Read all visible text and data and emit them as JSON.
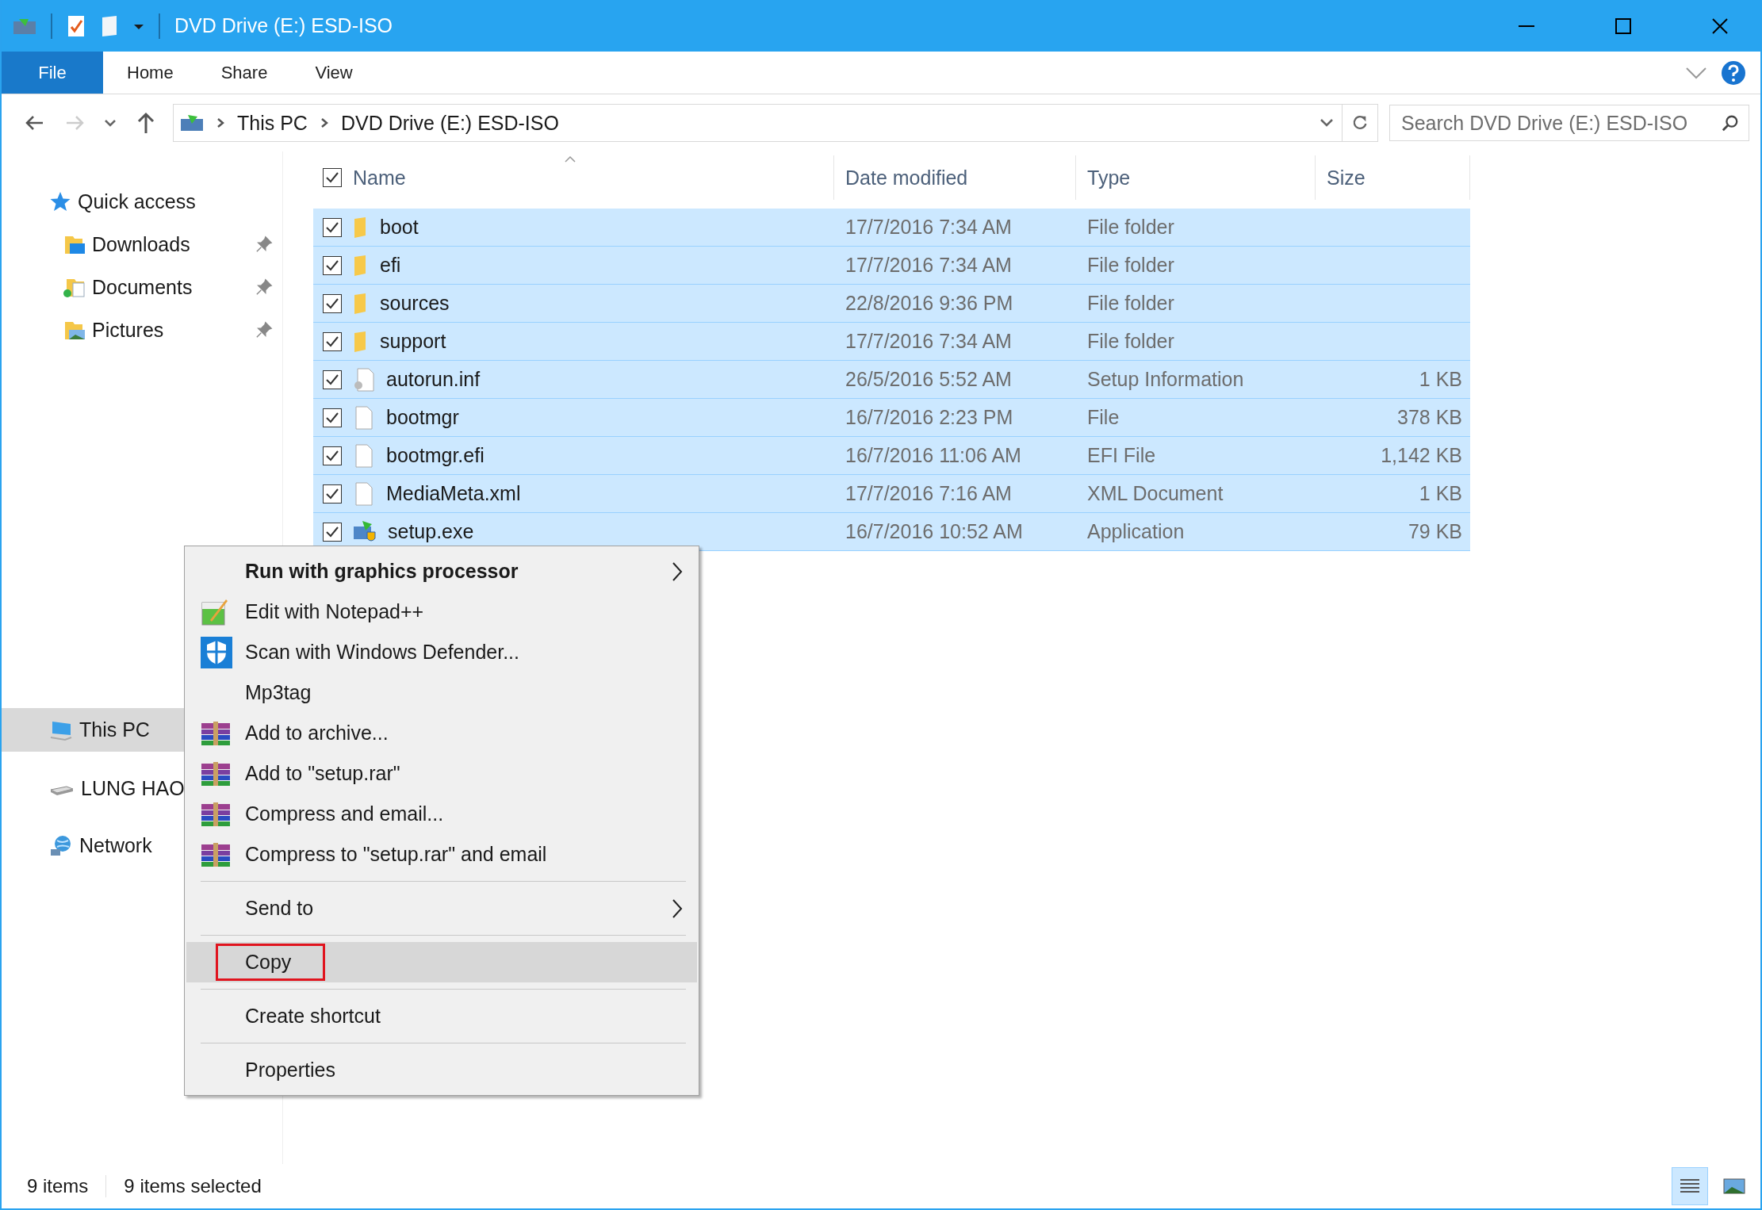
{
  "window": {
    "title": "DVD Drive (E:) ESD-ISO"
  },
  "ribbon_tabs": [
    {
      "label": "File",
      "kind": "file",
      "selected": false
    },
    {
      "label": "Home",
      "kind": "tab",
      "selected": false
    },
    {
      "label": "Share",
      "kind": "tab",
      "selected": false
    },
    {
      "label": "View",
      "kind": "tab",
      "selected": false
    }
  ],
  "address_bar": {
    "path": [
      "This PC",
      "DVD Drive (E:) ESD-ISO"
    ]
  },
  "search": {
    "placeholder": "Search DVD Drive (E:) ESD-ISO"
  },
  "sidebar": {
    "sections": [
      {
        "items": [
          {
            "label": "Quick access",
            "kind": "star",
            "selected": false,
            "children": [
              {
                "label": "Downloads",
                "kind": "downloads",
                "selected": false,
                "pinned": true
              },
              {
                "label": "Documents",
                "kind": "documents",
                "selected": false,
                "pinned": true
              },
              {
                "label": "Pictures",
                "kind": "pictures",
                "selected": false,
                "pinned": true
              }
            ]
          }
        ]
      },
      {
        "items": [
          {
            "label": "This PC",
            "kind": "pc",
            "selected": true
          },
          {
            "label": "LUNG HAO",
            "kind": "drive",
            "selected": false
          },
          {
            "label": "Network",
            "kind": "network",
            "selected": false
          }
        ]
      }
    ]
  },
  "table": {
    "all_checked": true,
    "columns": [
      "Name",
      "Date modified",
      "Type",
      "Size"
    ],
    "rows": [
      {
        "name": "boot",
        "date": "17/7/2016 7:34 AM",
        "type": "File folder",
        "size": "",
        "kind": "folder",
        "checked": true,
        "selected": true
      },
      {
        "name": "efi",
        "date": "17/7/2016 7:34 AM",
        "type": "File folder",
        "size": "",
        "kind": "folder",
        "checked": true,
        "selected": true
      },
      {
        "name": "sources",
        "date": "22/8/2016 9:36 PM",
        "type": "File folder",
        "size": "",
        "kind": "folder",
        "checked": true,
        "selected": true
      },
      {
        "name": "support",
        "date": "17/7/2016 7:34 AM",
        "type": "File folder",
        "size": "",
        "kind": "folder",
        "checked": true,
        "selected": true
      },
      {
        "name": "autorun.inf",
        "date": "26/5/2016 5:52 AM",
        "type": "Setup Information",
        "size": "1 KB",
        "kind": "settings",
        "checked": true,
        "selected": true
      },
      {
        "name": "bootmgr",
        "date": "16/7/2016 2:23 PM",
        "type": "File",
        "size": "378 KB",
        "kind": "file",
        "checked": true,
        "selected": true
      },
      {
        "name": "bootmgr.efi",
        "date": "16/7/2016 11:06 AM",
        "type": "EFI File",
        "size": "1,142 KB",
        "kind": "file",
        "checked": true,
        "selected": true
      },
      {
        "name": "MediaMeta.xml",
        "date": "17/7/2016 7:16 AM",
        "type": "XML Document",
        "size": "1 KB",
        "kind": "file",
        "checked": true,
        "selected": true
      },
      {
        "name": "setup.exe",
        "date": "16/7/2016 10:52 AM",
        "type": "Application",
        "size": "79 KB",
        "kind": "app",
        "checked": true,
        "selected": true
      }
    ]
  },
  "context_menu": {
    "items": [
      {
        "kind": "item",
        "label": "Run with graphics processor",
        "bold": true,
        "submenu": true,
        "highlighted": false,
        "outlined": false
      },
      {
        "kind": "notepad",
        "label": "Edit with Notepad++",
        "bold": false,
        "submenu": false,
        "highlighted": false,
        "outlined": false
      },
      {
        "kind": "shield",
        "label": "Scan with Windows Defender...",
        "bold": false,
        "submenu": false,
        "highlighted": false,
        "outlined": false
      },
      {
        "kind": "item",
        "label": "Mp3tag",
        "bold": false,
        "submenu": false,
        "highlighted": false,
        "outlined": false
      },
      {
        "kind": "archive",
        "label": "Add to archive...",
        "bold": false,
        "submenu": false,
        "highlighted": false,
        "outlined": false
      },
      {
        "kind": "archive",
        "label": "Add to \"setup.rar\"",
        "bold": false,
        "submenu": false,
        "highlighted": false,
        "outlined": false
      },
      {
        "kind": "archive",
        "label": "Compress and email...",
        "bold": false,
        "submenu": false,
        "highlighted": false,
        "outlined": false
      },
      {
        "kind": "archive",
        "label": "Compress to \"setup.rar\" and email",
        "bold": false,
        "submenu": false,
        "highlighted": false,
        "outlined": false
      },
      {
        "kind": "separator"
      },
      {
        "kind": "item",
        "label": "Send to",
        "bold": false,
        "submenu": true,
        "highlighted": false,
        "outlined": false
      },
      {
        "kind": "separator"
      },
      {
        "kind": "item",
        "label": "Copy",
        "bold": false,
        "submenu": false,
        "highlighted": true,
        "outlined": true
      },
      {
        "kind": "separator"
      },
      {
        "kind": "item",
        "label": "Create shortcut",
        "bold": false,
        "submenu": false,
        "highlighted": false,
        "outlined": false
      },
      {
        "kind": "separator"
      },
      {
        "kind": "item",
        "label": "Properties",
        "bold": false,
        "submenu": false,
        "highlighted": false,
        "outlined": false
      }
    ]
  },
  "status_bar": {
    "item_count": "9 items",
    "selection": "9 items selected",
    "views": [
      {
        "kind": "details",
        "selected": true
      },
      {
        "kind": "thumbnails",
        "selected": false
      }
    ]
  }
}
